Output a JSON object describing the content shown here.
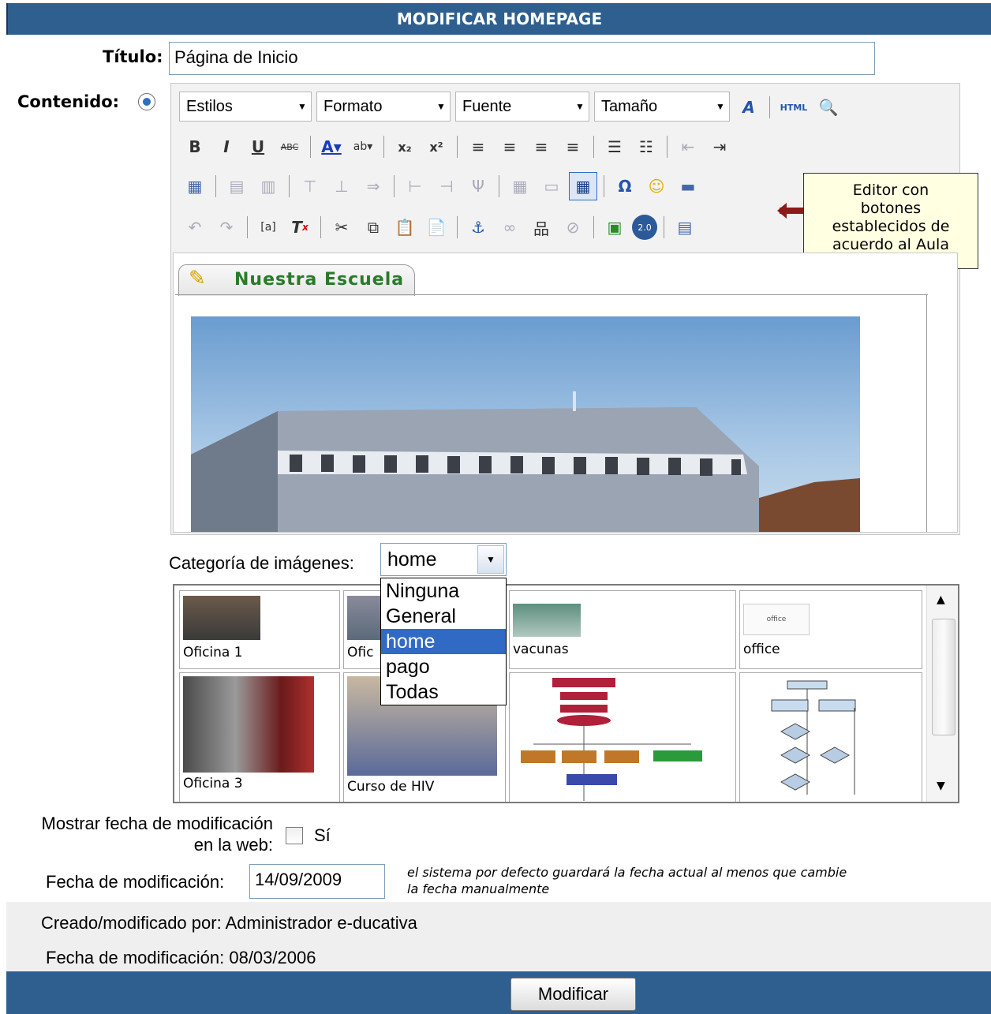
{
  "header": {
    "title": "MODIFICAR HOMEPAGE"
  },
  "form": {
    "titulo_label": "Título:",
    "titulo_value": "Página de Inicio",
    "contenido_label": "Contenido:"
  },
  "editor": {
    "selects": [
      "Estilos",
      "Formato",
      "Fuente",
      "Tamaño"
    ],
    "html_button": "HTML",
    "tab_label": "Nuestra Escuela"
  },
  "callout": {
    "line1": "Editor con",
    "line2": "botones",
    "line3": "establecidos de",
    "line4": "acuerdo al Aula"
  },
  "categoria": {
    "label": "Categoría de imágenes:",
    "selected": "home",
    "options": [
      "Ninguna",
      "General",
      "home",
      "pago",
      "Todas"
    ]
  },
  "gallery": {
    "items": [
      "Oficina 1",
      "Ofic",
      "vacunas",
      "office",
      "Oficina 3",
      "Curso de HIV"
    ],
    "office_logo": "office"
  },
  "fecha": {
    "mostrar_label_1": "Mostrar fecha de modificación",
    "mostrar_label_2": "en la web:",
    "si_label": "Sí",
    "fecha_label": "Fecha de modificación:",
    "fecha_value": "14/09/2009",
    "nota_1": "el sistema por defecto guardará la fecha actual al menos que cambie",
    "nota_2": "la fecha manualmente"
  },
  "info": {
    "creado": "Creado/modificado por: Administrador e-ducativa",
    "fecha_mod": "Fecha de modificación: 08/03/2006"
  },
  "footer": {
    "button": "Modificar"
  }
}
